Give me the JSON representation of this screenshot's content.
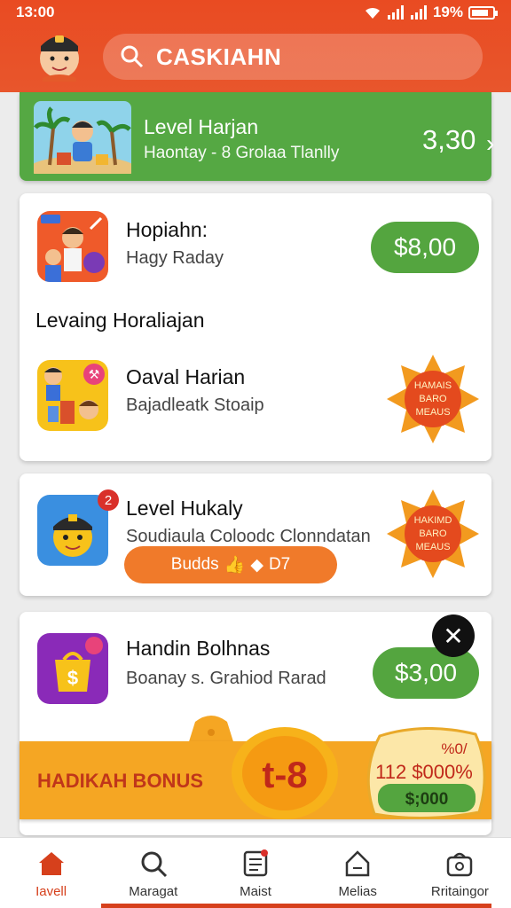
{
  "status_bar": {
    "time": "13:00",
    "battery": "19%"
  },
  "header": {
    "search_text": "CASKIAHN"
  },
  "banner": {
    "title": "Level Harjan",
    "subtitle": "Haontay - 8 Grolaa Tlanlly",
    "amount": "3,30",
    "chevron": "›"
  },
  "card1": {
    "item1": {
      "title": "Hopiahn:",
      "subtitle": "Hagy Raday",
      "amount": "$8,00"
    },
    "section_label": "Levaing  Horaliajan",
    "item2": {
      "title": "Oaval Harian",
      "subtitle": "Bajadleatk Stoaip",
      "badge_lines": [
        "HAMAIS",
        "BARO",
        "MEAUS"
      ]
    }
  },
  "card2": {
    "title": "Level Hukaly",
    "subtitle": "Soudiaula Coloodc Clonndatan",
    "notification_count": "2",
    "progress_label": "Budds",
    "progress_value": "D7",
    "badge_lines": [
      "HAKIMD",
      "BARO",
      "MEAUS"
    ]
  },
  "card3": {
    "title": "Handin Bolhnas",
    "subtitle": "Boanay s. Grahiod Rarad",
    "amount": "$3,00",
    "close": "✕"
  },
  "bonus": {
    "label": "HADIKAH BONUS",
    "coin_text": "t-8",
    "tag_line1": "%0/",
    "tag_line2": "112 $000%",
    "tag_amount": "$;000"
  },
  "nav": [
    {
      "label": "Iavell",
      "icon": "home-icon"
    },
    {
      "label": "Maragat",
      "icon": "search-icon"
    },
    {
      "label": "Maist",
      "icon": "list-icon"
    },
    {
      "label": "Melias",
      "icon": "house-outline-icon"
    },
    {
      "label": "Rritaingor",
      "icon": "bag-icon"
    }
  ],
  "colors": {
    "header": "#e94b22",
    "green": "#55a843",
    "orange": "#f07a2a",
    "bonus": "#f5a623",
    "active": "#d6401c"
  }
}
